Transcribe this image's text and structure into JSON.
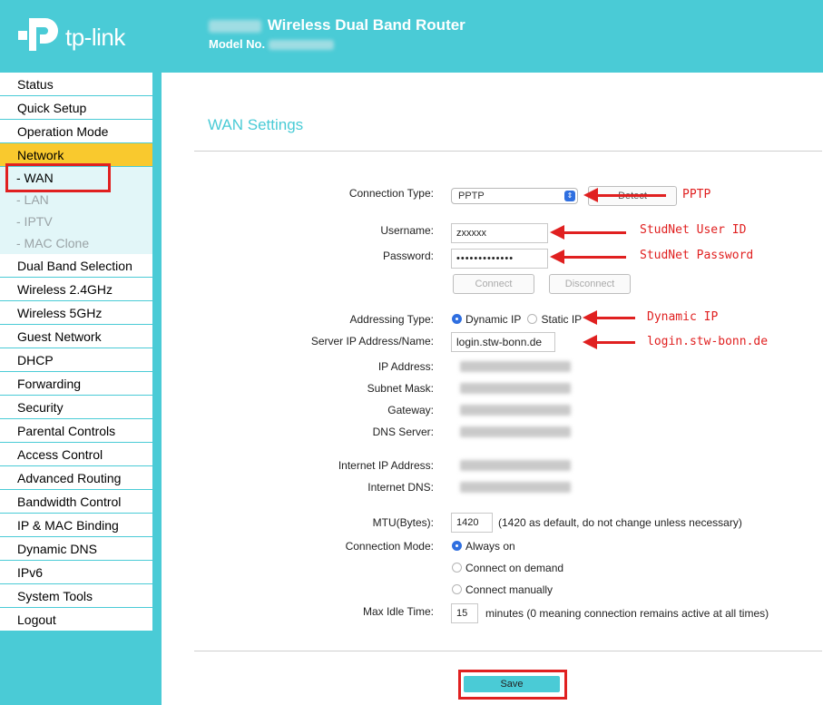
{
  "header": {
    "logo_text": "tp-link",
    "title": "Wireless Dual Band Router",
    "model_label": "Model No."
  },
  "sidebar": {
    "items": [
      {
        "label": "Status"
      },
      {
        "label": "Quick Setup"
      },
      {
        "label": "Operation Mode"
      },
      {
        "label": "Network",
        "active": true
      },
      {
        "label": "Dual Band Selection"
      },
      {
        "label": "Wireless 2.4GHz"
      },
      {
        "label": "Wireless 5GHz"
      },
      {
        "label": "Guest Network"
      },
      {
        "label": "DHCP"
      },
      {
        "label": "Forwarding"
      },
      {
        "label": "Security"
      },
      {
        "label": "Parental Controls"
      },
      {
        "label": "Access Control"
      },
      {
        "label": "Advanced Routing"
      },
      {
        "label": "Bandwidth Control"
      },
      {
        "label": "IP & MAC Binding"
      },
      {
        "label": "Dynamic DNS"
      },
      {
        "label": "IPv6"
      },
      {
        "label": "System Tools"
      },
      {
        "label": "Logout"
      }
    ],
    "network_sub": [
      {
        "label": "- WAN",
        "active": true
      },
      {
        "label": "- LAN"
      },
      {
        "label": "- IPTV"
      },
      {
        "label": "- MAC Clone"
      }
    ]
  },
  "main": {
    "page_title": "WAN Settings",
    "labels": {
      "connection_type": "Connection Type:",
      "username": "Username:",
      "password": "Password:",
      "addressing_type": "Addressing Type:",
      "server_ip": "Server IP Address/Name:",
      "ip_address": "IP Address:",
      "subnet_mask": "Subnet Mask:",
      "gateway": "Gateway:",
      "dns_server": "DNS Server:",
      "internet_ip": "Internet IP Address:",
      "internet_dns": "Internet DNS:",
      "mtu": "MTU(Bytes):",
      "connection_mode": "Connection Mode:",
      "max_idle": "Max Idle Time:"
    },
    "connection_type_value": "PPTP",
    "detect_label": "Detect",
    "username_value": "zxxxxx",
    "password_value": "•••••••••••••",
    "connect_label": "Connect",
    "disconnect_label": "Disconnect",
    "dynamic_ip_label": "Dynamic IP",
    "static_ip_label": "Static IP",
    "server_ip_value": "login.stw-bonn.de",
    "mtu_value": "1420",
    "mtu_note": "(1420 as default, do not change unless necessary)",
    "mode_always_on": "Always on",
    "mode_on_demand": "Connect on demand",
    "mode_manually": "Connect manually",
    "max_idle_value": "15",
    "max_idle_note": "minutes (0 meaning connection remains active at all times)",
    "save_label": "Save"
  },
  "annotations": {
    "pptp": "PPTP",
    "user_id": "StudNet User ID",
    "password": "StudNet Password",
    "dynamic_ip": "Dynamic IP",
    "server": "login.stw-bonn.de"
  },
  "colors": {
    "brand": "#4acbd6",
    "active_nav": "#f9c92e",
    "annotation": "#e02020",
    "radio_selected": "#2f6fe0"
  }
}
